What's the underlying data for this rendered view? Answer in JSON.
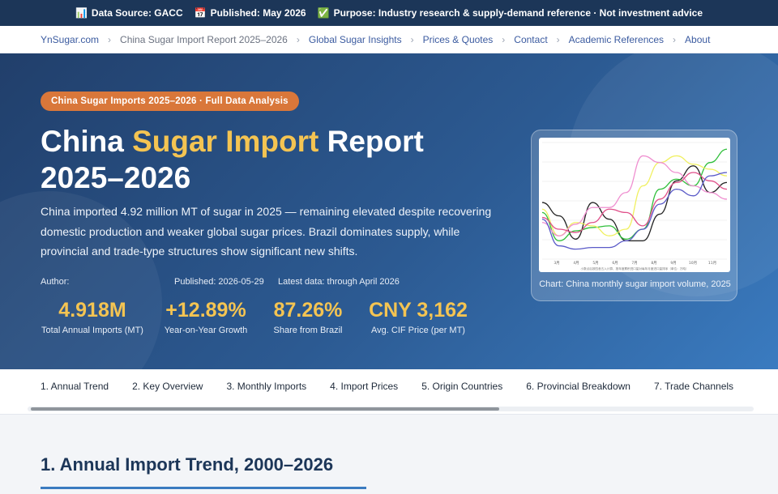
{
  "topbar": {
    "items": [
      {
        "icon": "chart-icon",
        "glyph": "📊",
        "text": "Data Source: GACC"
      },
      {
        "icon": "calendar-icon",
        "glyph": "📅",
        "text": "Published: May 2026"
      },
      {
        "icon": "check-icon",
        "glyph": "✅",
        "text": "Purpose: Industry research & supply-demand reference · Not investment advice"
      }
    ]
  },
  "breadcrumb": [
    {
      "label": "YnSugar.com"
    },
    {
      "label": "China Sugar Import Report 2025–2026"
    },
    {
      "label": "Global Sugar Insights"
    },
    {
      "label": "Prices & Quotes"
    },
    {
      "label": "Contact"
    },
    {
      "label": "Academic References"
    },
    {
      "label": "About"
    }
  ],
  "hero": {
    "pill": "China Sugar Imports 2025–2026 · Full Data Analysis",
    "title_pre": "China ",
    "title_accent": "Sugar Import",
    "title_post": " Report",
    "title_line2": "2025–2026",
    "description": "China imported 4.92 million MT of sugar in 2025 — remaining elevated despite recovering domestic production and weaker global sugar prices. Brazil dominates supply, while provincial and trade-type structures show significant new shifts.",
    "author_label": "Author:",
    "published": "Published: 2026-05-29",
    "latest": "Latest data: through April 2026",
    "stats": [
      {
        "value": "4.918M",
        "label": "Total Annual Imports (MT)"
      },
      {
        "value": "+12.89%",
        "label": "Year-on-Year Growth"
      },
      {
        "value": "87.26%",
        "label": "Share from Brazil"
      },
      {
        "value": "CNY 3,162",
        "label": "Avg. CIF Price (per MT)"
      }
    ],
    "chart_caption": "Chart: China monthly sugar import volume, 2025"
  },
  "thumbnail": {
    "x_labels": [
      "3月",
      "4月",
      "5月",
      "6月",
      "7月",
      "8月",
      "9月",
      "10月",
      "11月"
    ],
    "note": "小数点后按四舍五入计算，按年度累积进口量对每年月度进口量排序（单位：万吨）",
    "series": [
      {
        "color": "#222222",
        "values": [
          34,
          26,
          12,
          34,
          24,
          11,
          11,
          27,
          47,
          56,
          40,
          46
        ]
      },
      {
        "color": "#2fbf3a",
        "values": [
          28,
          11,
          17,
          19,
          20,
          12,
          18,
          42,
          48,
          44,
          58,
          66
        ]
      },
      {
        "color": "#f0f060",
        "values": [
          30,
          14,
          22,
          20,
          14,
          18,
          44,
          58,
          62,
          57,
          54,
          50
        ]
      },
      {
        "color": "#ef8fd0",
        "values": [
          22,
          14,
          21,
          31,
          31,
          40,
          62,
          58,
          52,
          44,
          40,
          36
        ]
      },
      {
        "color": "#e0508a",
        "values": [
          25,
          18,
          16,
          22,
          30,
          28,
          20,
          36,
          46,
          52,
          47,
          42
        ]
      },
      {
        "color": "#5a5ac8",
        "values": [
          24,
          8,
          6,
          7,
          7,
          11,
          18,
          33,
          42,
          38,
          50,
          52
        ]
      }
    ]
  },
  "tabs": [
    {
      "label": "1. Annual Trend"
    },
    {
      "label": "2. Key Overview"
    },
    {
      "label": "3. Monthly Imports"
    },
    {
      "label": "4. Import Prices"
    },
    {
      "label": "5. Origin Countries"
    },
    {
      "label": "6. Provincial Breakdown"
    },
    {
      "label": "7. Trade Channels"
    }
  ],
  "section": {
    "title": "1. Annual Import Trend, 2000–2026"
  }
}
